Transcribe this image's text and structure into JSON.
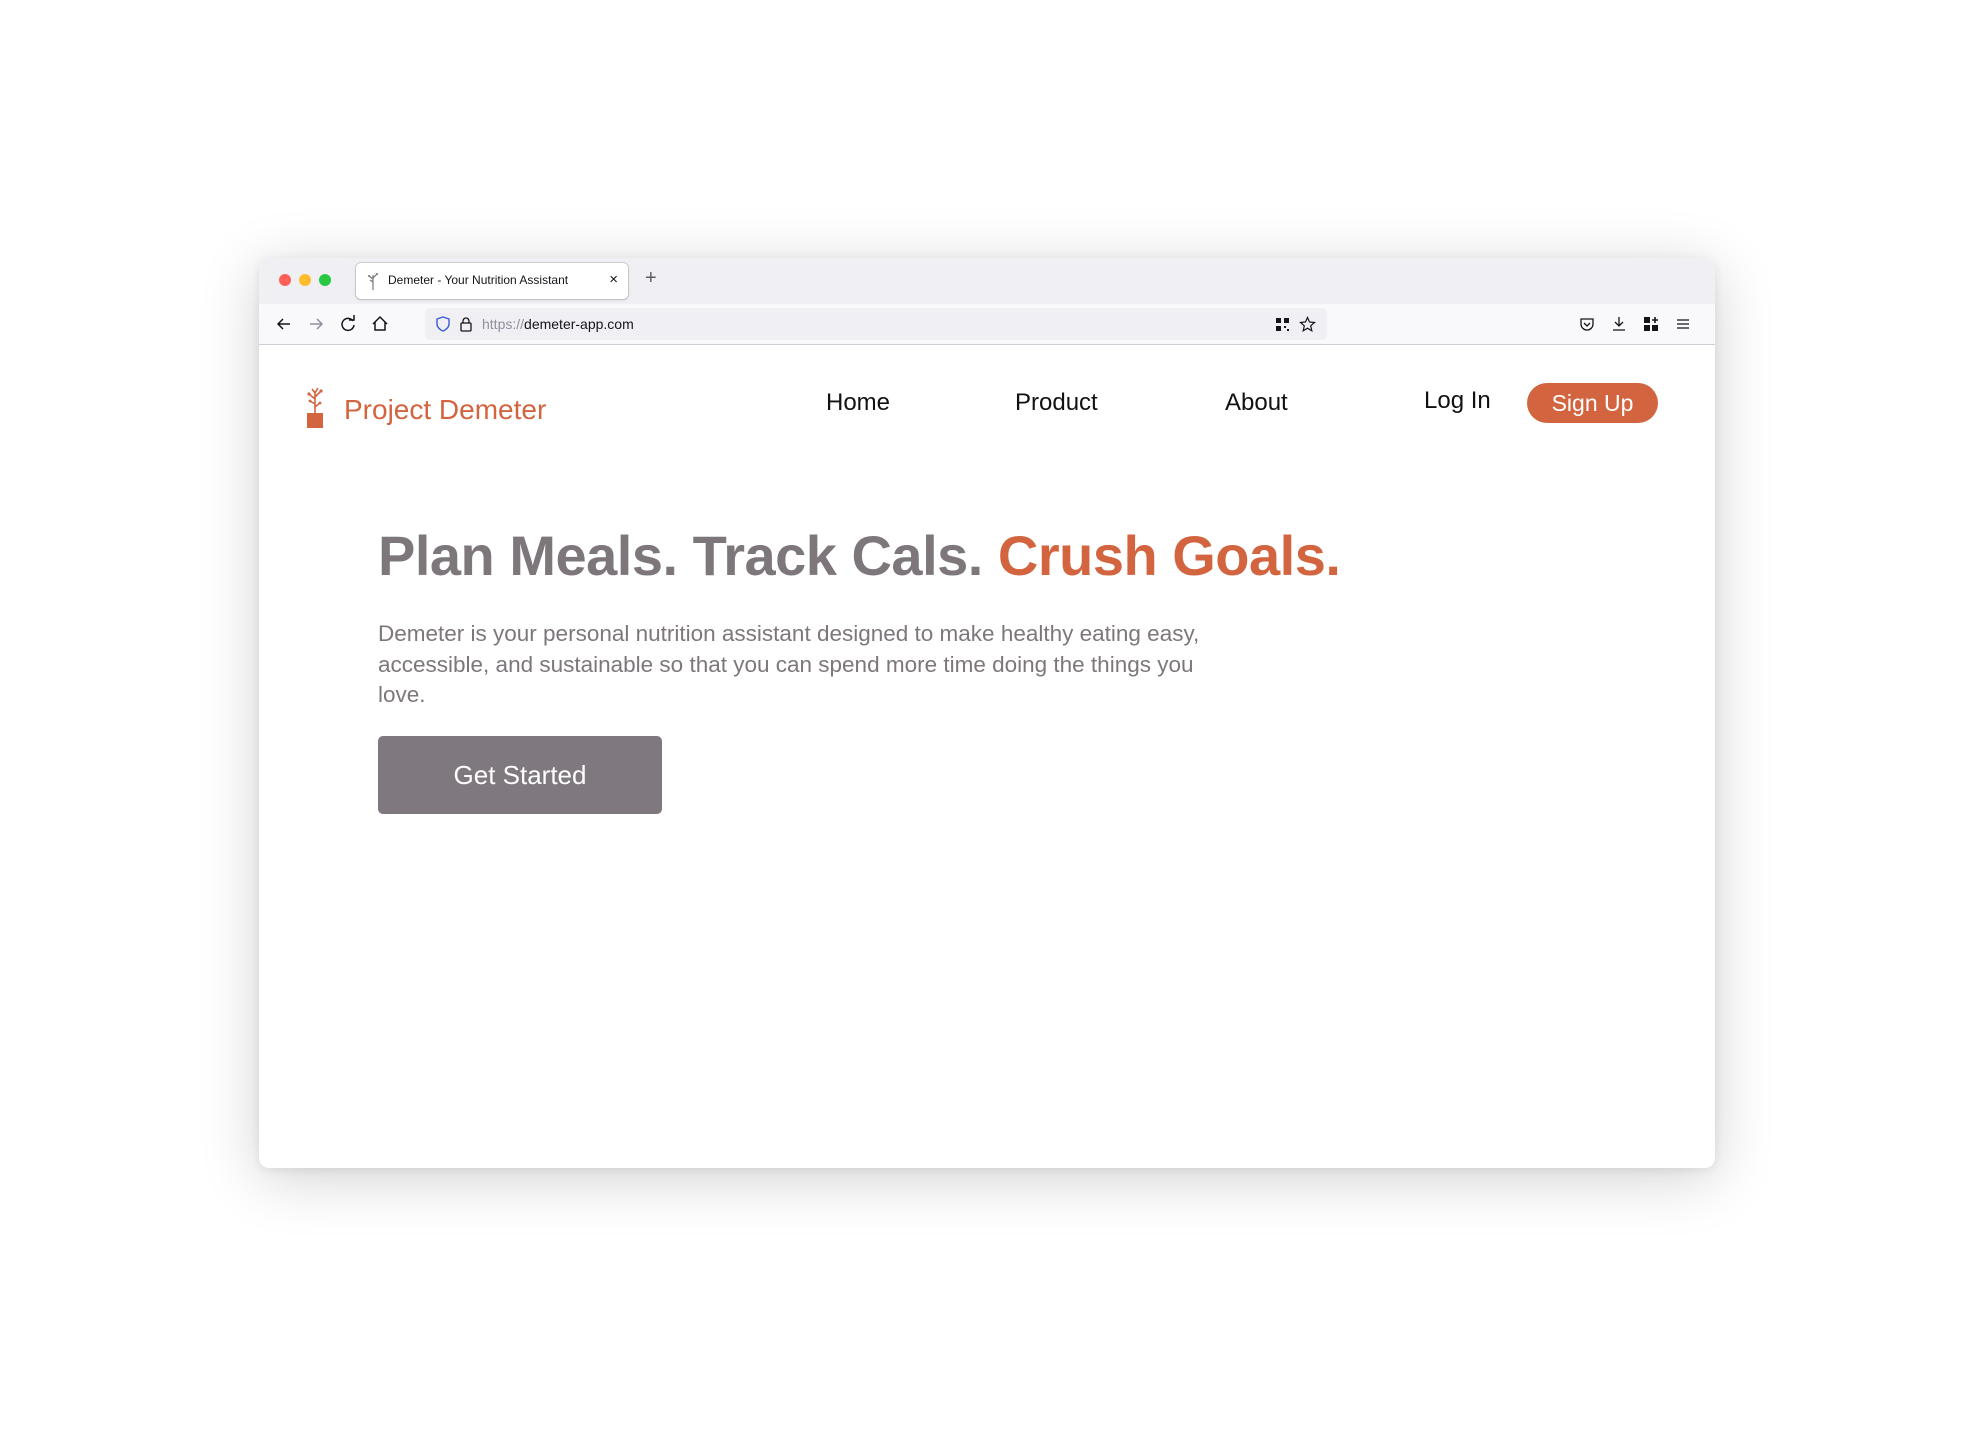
{
  "browser": {
    "tab": {
      "title": "Demeter - Your Nutrition Assistant",
      "close_label": "×"
    },
    "new_tab_label": "+",
    "url": {
      "scheme": "https://",
      "host": "demeter-app.com"
    },
    "icons": [
      "back-icon",
      "forward-icon",
      "reload-icon",
      "home-icon",
      "shield-icon",
      "lock-icon",
      "qr-icon",
      "bookmark-star-icon",
      "pocket-icon",
      "download-icon",
      "extensions-icon",
      "menu-icon"
    ]
  },
  "site": {
    "brand": {
      "name": "Project Demeter",
      "color": "#d2653f"
    },
    "nav": {
      "home": "Home",
      "product": "Product",
      "about": "About"
    },
    "auth": {
      "login": "Log In",
      "signup": "Sign Up"
    },
    "hero": {
      "title_main": "Plan Meals. Track Cals. ",
      "title_accent": "Crush Goals.",
      "body": "Demeter is your personal nutrition assistant designed to make healthy eating easy, accessible, and sustainable so that you can spend more time doing the things you love.",
      "cta": "Get Started"
    },
    "colors": {
      "accent": "#d2653f",
      "muted": "#7d777c",
      "button": "#7f787e"
    }
  }
}
